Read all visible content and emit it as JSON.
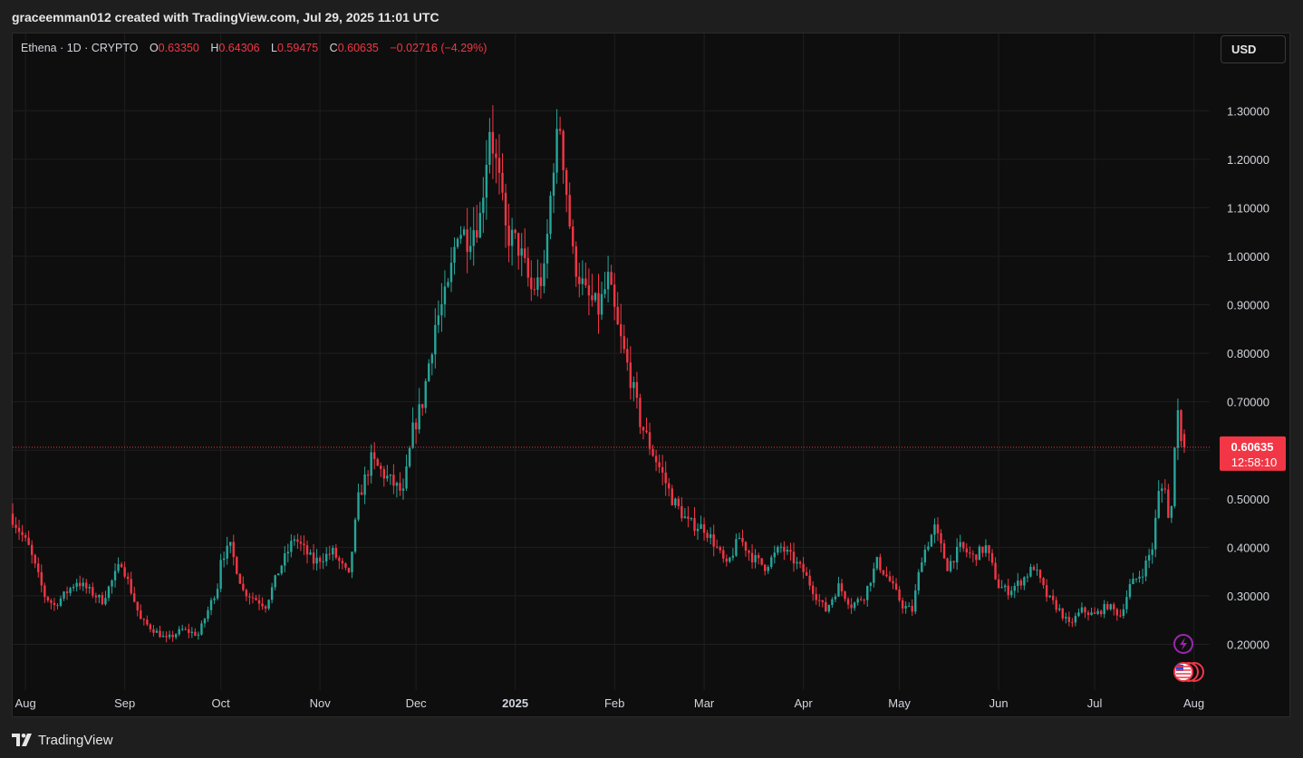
{
  "header": {
    "text": "graceemman012 created with TradingView.com, Jul 29, 2025 11:01 UTC"
  },
  "legend": {
    "symbol": "Ethena · 1D · CRYPTO",
    "open_label": "O",
    "open": "0.63350",
    "high_label": "H",
    "high": "0.64306",
    "low_label": "L",
    "low": "0.59475",
    "close_label": "C",
    "close": "0.60635",
    "change": "−0.02716 (−4.29%)"
  },
  "currency_button": "USD",
  "price_badge": {
    "price": "0.60635",
    "countdown": "12:58:10"
  },
  "footer": {
    "brand": "TradingView"
  },
  "colors": {
    "up": "#26a69a",
    "down": "#f23645",
    "background": "#0e0e0e",
    "grid": "#1f1f1f",
    "text": "#d1d4dc"
  },
  "icons": {
    "event_icon": "lightning-icon",
    "flag_icon": "us-flag-icon"
  },
  "chart_data": {
    "type": "candlestick",
    "title": "Ethena · 1D · CRYPTO",
    "ylim": [
      0.13,
      1.345
    ],
    "y_ticks": [
      "1.30000",
      "1.20000",
      "1.10000",
      "1.00000",
      "0.90000",
      "0.80000",
      "0.70000",
      "0.60000",
      "0.50000",
      "0.40000",
      "0.30000",
      "0.20000"
    ],
    "y_tick_values": [
      1.3,
      1.2,
      1.1,
      1.0,
      0.9,
      0.8,
      0.7,
      0.6,
      0.5,
      0.4,
      0.3,
      0.2
    ],
    "x_ticks": [
      "Aug",
      "Sep",
      "Oct",
      "Nov",
      "Dec",
      "2025",
      "Feb",
      "Mar",
      "Apr",
      "May",
      "Jun",
      "Jul",
      "Aug"
    ],
    "x_tick_dates": [
      "2024-08-01",
      "2024-09-01",
      "2024-10-01",
      "2024-11-01",
      "2024-12-01",
      "2025-01-01",
      "2025-02-01",
      "2025-03-01",
      "2025-04-01",
      "2025-05-01",
      "2025-06-01",
      "2025-07-01",
      "2025-08-01"
    ],
    "last_price": 0.60635,
    "close_path": [
      [
        "2024-07-28",
        0.46
      ],
      [
        "2024-08-02",
        0.4
      ],
      [
        "2024-08-07",
        0.3
      ],
      [
        "2024-08-10",
        0.28
      ],
      [
        "2024-08-17",
        0.33
      ],
      [
        "2024-08-25",
        0.29
      ],
      [
        "2024-08-31",
        0.37
      ],
      [
        "2024-09-06",
        0.25
      ],
      [
        "2024-09-14",
        0.21
      ],
      [
        "2024-09-19",
        0.23
      ],
      [
        "2024-09-24",
        0.22
      ],
      [
        "2024-09-30",
        0.32
      ],
      [
        "2024-10-01",
        0.38
      ],
      [
        "2024-10-04",
        0.4
      ],
      [
        "2024-10-08",
        0.31
      ],
      [
        "2024-10-15",
        0.28
      ],
      [
        "2024-10-19",
        0.35
      ],
      [
        "2024-10-24",
        0.42
      ],
      [
        "2024-10-30",
        0.37
      ],
      [
        "2024-11-05",
        0.39
      ],
      [
        "2024-11-10",
        0.34
      ],
      [
        "2024-11-13",
        0.5
      ],
      [
        "2024-11-17",
        0.58
      ],
      [
        "2024-11-21",
        0.55
      ],
      [
        "2024-11-27",
        0.51
      ],
      [
        "2024-11-30",
        0.64
      ],
      [
        "2024-12-03",
        0.7
      ],
      [
        "2024-12-07",
        0.86
      ],
      [
        "2024-12-11",
        0.93
      ],
      [
        "2024-12-14",
        1.06
      ],
      [
        "2024-12-17",
        1.04
      ],
      [
        "2024-12-21",
        1.08
      ],
      [
        "2024-12-24",
        1.27
      ],
      [
        "2024-12-27",
        1.15
      ],
      [
        "2024-12-29",
        1.05
      ],
      [
        "2025-01-02",
        1.02
      ],
      [
        "2025-01-06",
        0.93
      ],
      [
        "2025-01-10",
        0.96
      ],
      [
        "2025-01-13",
        1.2
      ],
      [
        "2025-01-15",
        1.27
      ],
      [
        "2025-01-19",
        1.0
      ],
      [
        "2025-01-23",
        0.92
      ],
      [
        "2025-01-27",
        0.89
      ],
      [
        "2025-01-30",
        0.95
      ],
      [
        "2025-02-02",
        0.85
      ],
      [
        "2025-02-06",
        0.75
      ],
      [
        "2025-02-09",
        0.66
      ],
      [
        "2025-02-12",
        0.61
      ],
      [
        "2025-02-16",
        0.55
      ],
      [
        "2025-02-19",
        0.5
      ],
      [
        "2025-02-24",
        0.45
      ],
      [
        "2025-03-01",
        0.44
      ],
      [
        "2025-03-04",
        0.41
      ],
      [
        "2025-03-08",
        0.36
      ],
      [
        "2025-03-12",
        0.42
      ],
      [
        "2025-03-16",
        0.38
      ],
      [
        "2025-03-20",
        0.36
      ],
      [
        "2025-03-25",
        0.4
      ],
      [
        "2025-03-28",
        0.38
      ],
      [
        "2025-04-01",
        0.35
      ],
      [
        "2025-04-05",
        0.3
      ],
      [
        "2025-04-08",
        0.27
      ],
      [
        "2025-04-12",
        0.32
      ],
      [
        "2025-04-16",
        0.28
      ],
      [
        "2025-04-20",
        0.3
      ],
      [
        "2025-04-24",
        0.37
      ],
      [
        "2025-04-28",
        0.33
      ],
      [
        "2025-05-02",
        0.28
      ],
      [
        "2025-05-05",
        0.27
      ],
      [
        "2025-05-08",
        0.38
      ],
      [
        "2025-05-12",
        0.44
      ],
      [
        "2025-05-16",
        0.36
      ],
      [
        "2025-05-20",
        0.4
      ],
      [
        "2025-05-24",
        0.38
      ],
      [
        "2025-05-28",
        0.4
      ],
      [
        "2025-06-01",
        0.32
      ],
      [
        "2025-06-04",
        0.31
      ],
      [
        "2025-06-08",
        0.33
      ],
      [
        "2025-06-12",
        0.36
      ],
      [
        "2025-06-16",
        0.3
      ],
      [
        "2025-06-20",
        0.27
      ],
      [
        "2025-06-23",
        0.24
      ],
      [
        "2025-06-27",
        0.27
      ],
      [
        "2025-07-01",
        0.26
      ],
      [
        "2025-07-05",
        0.28
      ],
      [
        "2025-07-09",
        0.26
      ],
      [
        "2025-07-12",
        0.32
      ],
      [
        "2025-07-16",
        0.35
      ],
      [
        "2025-07-19",
        0.4
      ],
      [
        "2025-07-21",
        0.51
      ],
      [
        "2025-07-23",
        0.53
      ],
      [
        "2025-07-24",
        0.46
      ],
      [
        "2025-07-25",
        0.48
      ],
      [
        "2025-07-26",
        0.62
      ],
      [
        "2025-07-27",
        0.68
      ],
      [
        "2025-07-28",
        0.63
      ],
      [
        "2025-07-29",
        0.60635
      ]
    ]
  }
}
